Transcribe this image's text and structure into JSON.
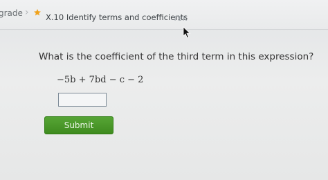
{
  "breadcrumb": {
    "grade": "grade",
    "separator": "›",
    "skill": "X.10 Identify terms and coefficients",
    "code": "T8K",
    "icon": "star-icon"
  },
  "problem": {
    "question": "What is the coefficient of the third term in this expression?",
    "expression": "−5b + 7bd − c − 2",
    "answer_value": ""
  },
  "actions": {
    "submit_label": "Submit"
  },
  "colors": {
    "submit_green": "#4a9a2b",
    "star_orange": "#f0a21c"
  }
}
